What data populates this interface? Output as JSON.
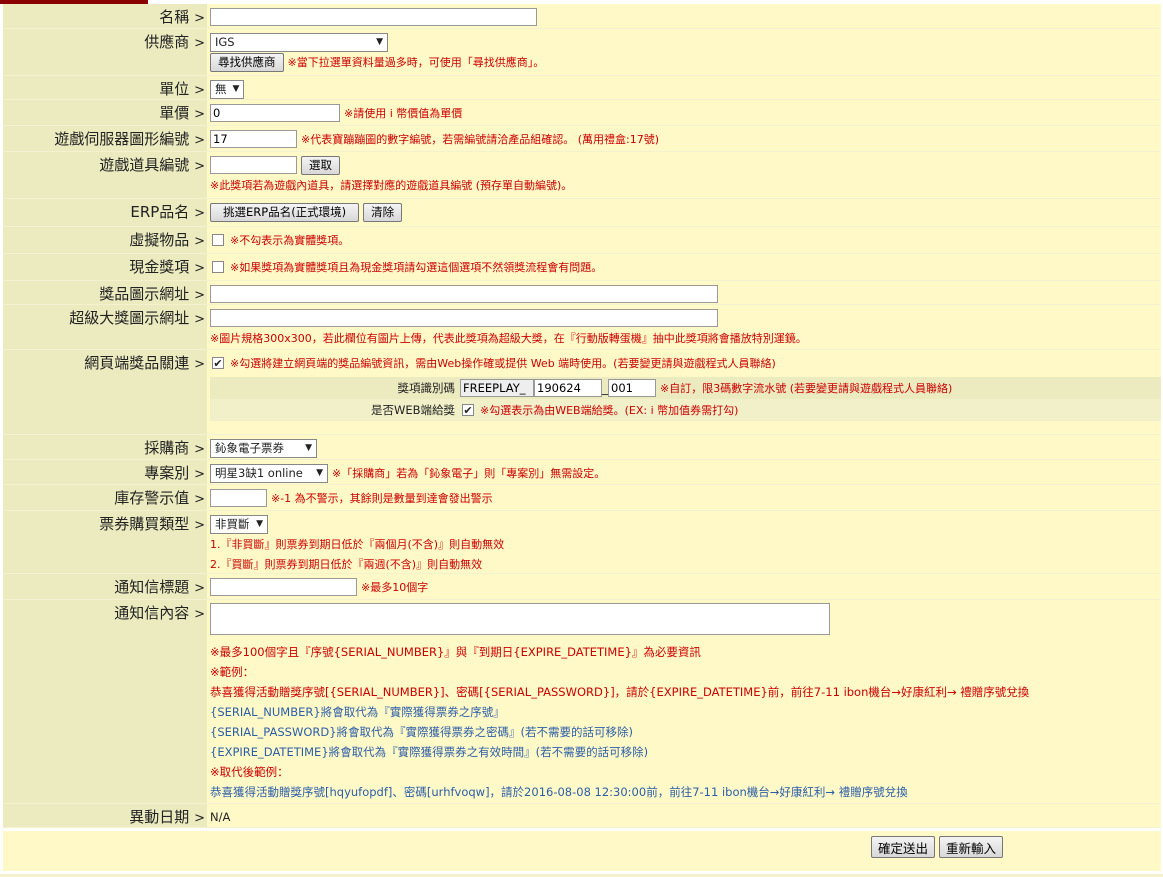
{
  "fields": {
    "name": {
      "label": "名稱",
      "value": ""
    },
    "supplier": {
      "label": "供應商",
      "selected": "IGS",
      "find_button": "尋找供應商",
      "note": "※當下拉選單資料量過多時，可使用「尋找供應商」。"
    },
    "unit": {
      "label": "單位",
      "selected": "無"
    },
    "price": {
      "label": "單價",
      "value": "0",
      "note": "※請使用 i 幣價值為單價"
    },
    "server_icon": {
      "label": "遊戲伺服器圖形編號",
      "value": "17",
      "note": "※代表寶蹦蹦圖的數字編號，若需編號請洽產品組確認。 (萬用禮盒:17號)"
    },
    "item_code": {
      "label": "遊戲道具編號",
      "value": "",
      "select_button": "選取",
      "note": "※此獎項若為遊戲內道具，請選擇對應的遊戲道具編號 (預存單自動編號)。"
    },
    "erp": {
      "label": "ERP品名",
      "pick_button": "挑選ERP品名(正式環境)",
      "clear_button": "清除"
    },
    "virtual": {
      "label": "虛擬物品",
      "checked": false,
      "note": "※不勾表示為實體獎項。"
    },
    "cash": {
      "label": "現金獎項",
      "checked": false,
      "note": "※如果獎項為實體獎項且為現金獎項請勾選這個選項不然領獎流程會有問題。"
    },
    "prize_image": {
      "label": "獎品圖示網址",
      "value": ""
    },
    "grand_prize_image": {
      "label": "超級大獎圖示網址",
      "value": "",
      "note": "※圖片規格300x300，若此欄位有圖片上傳，代表此獎項為超級大獎，在『行動版轉蛋機』抽中此獎項將會播放特別運鏡。"
    },
    "web_link": {
      "label": "網頁端獎品關連",
      "checked": true,
      "note": "※勾選將建立網頁端的獎品編號資訊，需由Web操作確或提供 Web 端時使用。(若要變更請與遊戲程式人員聯絡)",
      "code_label": "獎項識別碼",
      "code_prefix": "FREEPLAY_",
      "code_mid": "190624",
      "code_sep": "_",
      "code_suffix": "001",
      "code_note": "※自訂，限3碼數字流水號 (若要變更請與遊戲程式人員聯絡)",
      "web_award_label": "是否WEB端給獎",
      "web_award_checked": true,
      "web_award_note": "※勾選表示為由WEB端給獎。(EX: i 幣加值券需打勾)"
    },
    "purchaser": {
      "label": "採購商",
      "selected": "鈊象電子票券"
    },
    "project": {
      "label": "專案別",
      "selected": "明星3缺1 online",
      "note": "※「採購商」若為「鈊象電子」則「專案別」無需設定。"
    },
    "stock_alert": {
      "label": "庫存警示值",
      "value": "",
      "note": "※-1 為不警示，其餘則是數量到達會發出警示"
    },
    "ticket_type": {
      "label": "票券購買類型",
      "selected": "非買斷",
      "notes": [
        "1.『非買斷』則票券到期日低於『兩個月(不含)』則自動無效",
        "2.『買斷』則票券到期日低於『兩週(不含)』則自動無效"
      ]
    },
    "mail_title": {
      "label": "通知信標題",
      "value": "",
      "note": "※最多10個字"
    },
    "mail_content": {
      "label": "通知信內容",
      "value": "",
      "lines": [
        {
          "text": "※最多100個字且『序號{SERIAL_NUMBER}』與『到期日{EXPIRE_DATETIME}』為必要資訊",
          "style": "red"
        },
        {
          "text": "※範例：",
          "style": "red"
        },
        {
          "text": "恭喜獲得活動贈獎序號[{SERIAL_NUMBER}]、密碼[{SERIAL_PASSWORD}]，請於{EXPIRE_DATETIME}前，前往7-11 ibon機台→好康紅利→ 禮贈序號兌換",
          "style": "red"
        },
        {
          "text": "{SERIAL_NUMBER}將會取代為『實際獲得票券之序號』",
          "style": "blue"
        },
        {
          "text": "{SERIAL_PASSWORD}將會取代為『實際獲得票券之密碼』(若不需要的話可移除)",
          "style": "blue"
        },
        {
          "text": "{EXPIRE_DATETIME}將會取代為『實際獲得票券之有效時間』(若不需要的話可移除)",
          "style": "blue"
        },
        {
          "text": "※取代後範例：",
          "style": "red"
        },
        {
          "text": "恭喜獲得活動贈獎序號[hqyufopdf]、密碼[urhfvoqw]，請於2016-08-08 12:30:00前，前往7-11 ibon機台→好康紅利→ 禮贈序號兌換",
          "style": "blue"
        }
      ]
    },
    "change_date": {
      "label": "異動日期",
      "value": "N/A"
    }
  },
  "actions": {
    "submit": "確定送出",
    "reset": "重新輸入"
  },
  "arrow": ">"
}
